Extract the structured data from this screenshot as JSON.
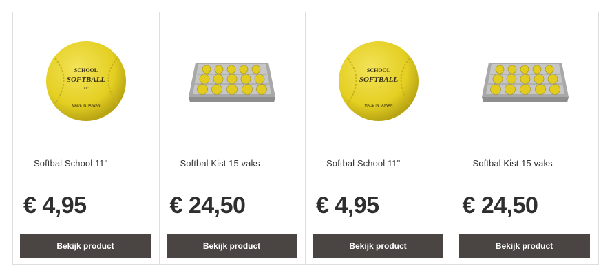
{
  "products": [
    {
      "name": "Softbal School 11\"",
      "price": "€ 4,95",
      "button": "Bekijk product",
      "image": "softball-ball",
      "ball_text": [
        "SCHOOL",
        "SOFTBALL",
        "11\"",
        "MADE IN TAIWAN"
      ]
    },
    {
      "name": "Softbal Kist 15 vaks",
      "price": "€ 24,50",
      "button": "Bekijk product",
      "image": "softball-crate"
    },
    {
      "name": "Softbal School 11\"",
      "price": "€ 4,95",
      "button": "Bekijk product",
      "image": "softball-ball",
      "ball_text": [
        "SCHOOL",
        "SOFTBALL",
        "11\"",
        "MADE IN TAIWAN"
      ]
    },
    {
      "name": "Softbal Kist 15 vaks",
      "price": "€ 24,50",
      "button": "Bekijk product",
      "image": "softball-crate"
    }
  ],
  "colors": {
    "button_bg": "#4a4442",
    "ball_yellow": "#e8d52a",
    "border": "#dedede"
  }
}
